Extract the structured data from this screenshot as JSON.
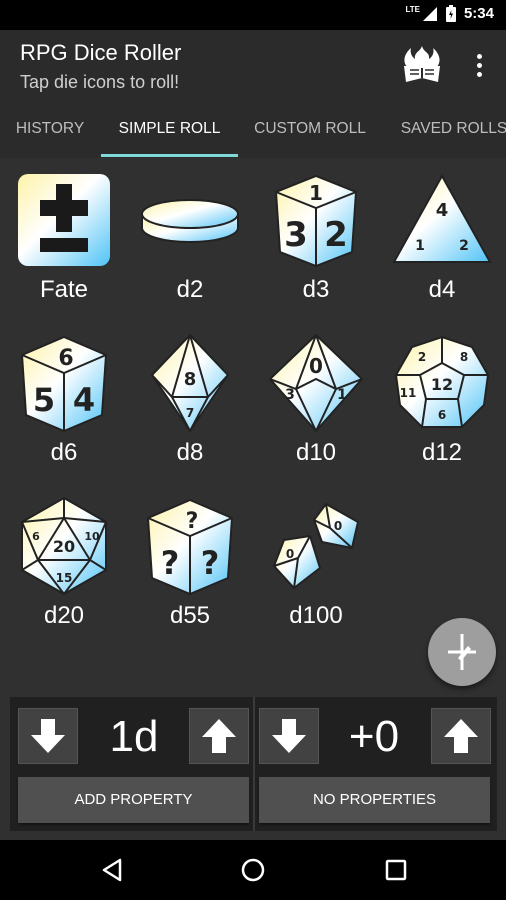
{
  "status_bar": {
    "time": "5:34",
    "network": "LTE"
  },
  "app_bar": {
    "title": "RPG Dice Roller",
    "subtitle": "Tap die icons to roll!"
  },
  "tabs": [
    {
      "label": "HISTORY",
      "active": false
    },
    {
      "label": "SIMPLE ROLL",
      "active": true
    },
    {
      "label": "CUSTOM ROLL",
      "active": false
    },
    {
      "label": "SAVED ROLLS",
      "active": false
    }
  ],
  "dice": [
    {
      "label": "Fate",
      "icon": "fate-die-icon"
    },
    {
      "label": "d2",
      "icon": "coin-icon"
    },
    {
      "label": "d3",
      "icon": "d3-die-icon"
    },
    {
      "label": "d4",
      "icon": "d4-die-icon"
    },
    {
      "label": "d6",
      "icon": "d6-die-icon"
    },
    {
      "label": "d8",
      "icon": "d8-die-icon"
    },
    {
      "label": "d10",
      "icon": "d10-die-icon"
    },
    {
      "label": "d12",
      "icon": "d12-die-icon"
    },
    {
      "label": "d20",
      "icon": "d20-die-icon"
    },
    {
      "label": "d55",
      "icon": "custom-die-icon"
    },
    {
      "label": "d100",
      "icon": "percentile-dice-icon"
    }
  ],
  "die_faces": {
    "d3": [
      "1",
      "3",
      "2"
    ],
    "d4": [
      "4",
      "1",
      "2"
    ],
    "d6": [
      "6",
      "5",
      "4"
    ],
    "d8": [
      "8",
      "7"
    ],
    "d10": [
      "0",
      "3",
      "1"
    ],
    "d12": [
      "12",
      "2",
      "8",
      "11",
      "6"
    ],
    "d20": [
      "20",
      "15",
      "6",
      "10"
    ],
    "d55": [
      "?",
      "?",
      "?"
    ],
    "d100": [
      "0",
      "0"
    ]
  },
  "controls": {
    "count_value": "1d",
    "modifier_value": "+0",
    "add_property_label": "ADD PROPERTY",
    "properties_label": "NO PROPERTIES"
  },
  "colors": {
    "accent": "#7fd9d9",
    "app_bar": "#2b2b2b",
    "background": "#303030",
    "fab": "#9e9e9e",
    "die_gradient_start": "#fdf3a8",
    "die_gradient_end": "#4fc3f7"
  }
}
